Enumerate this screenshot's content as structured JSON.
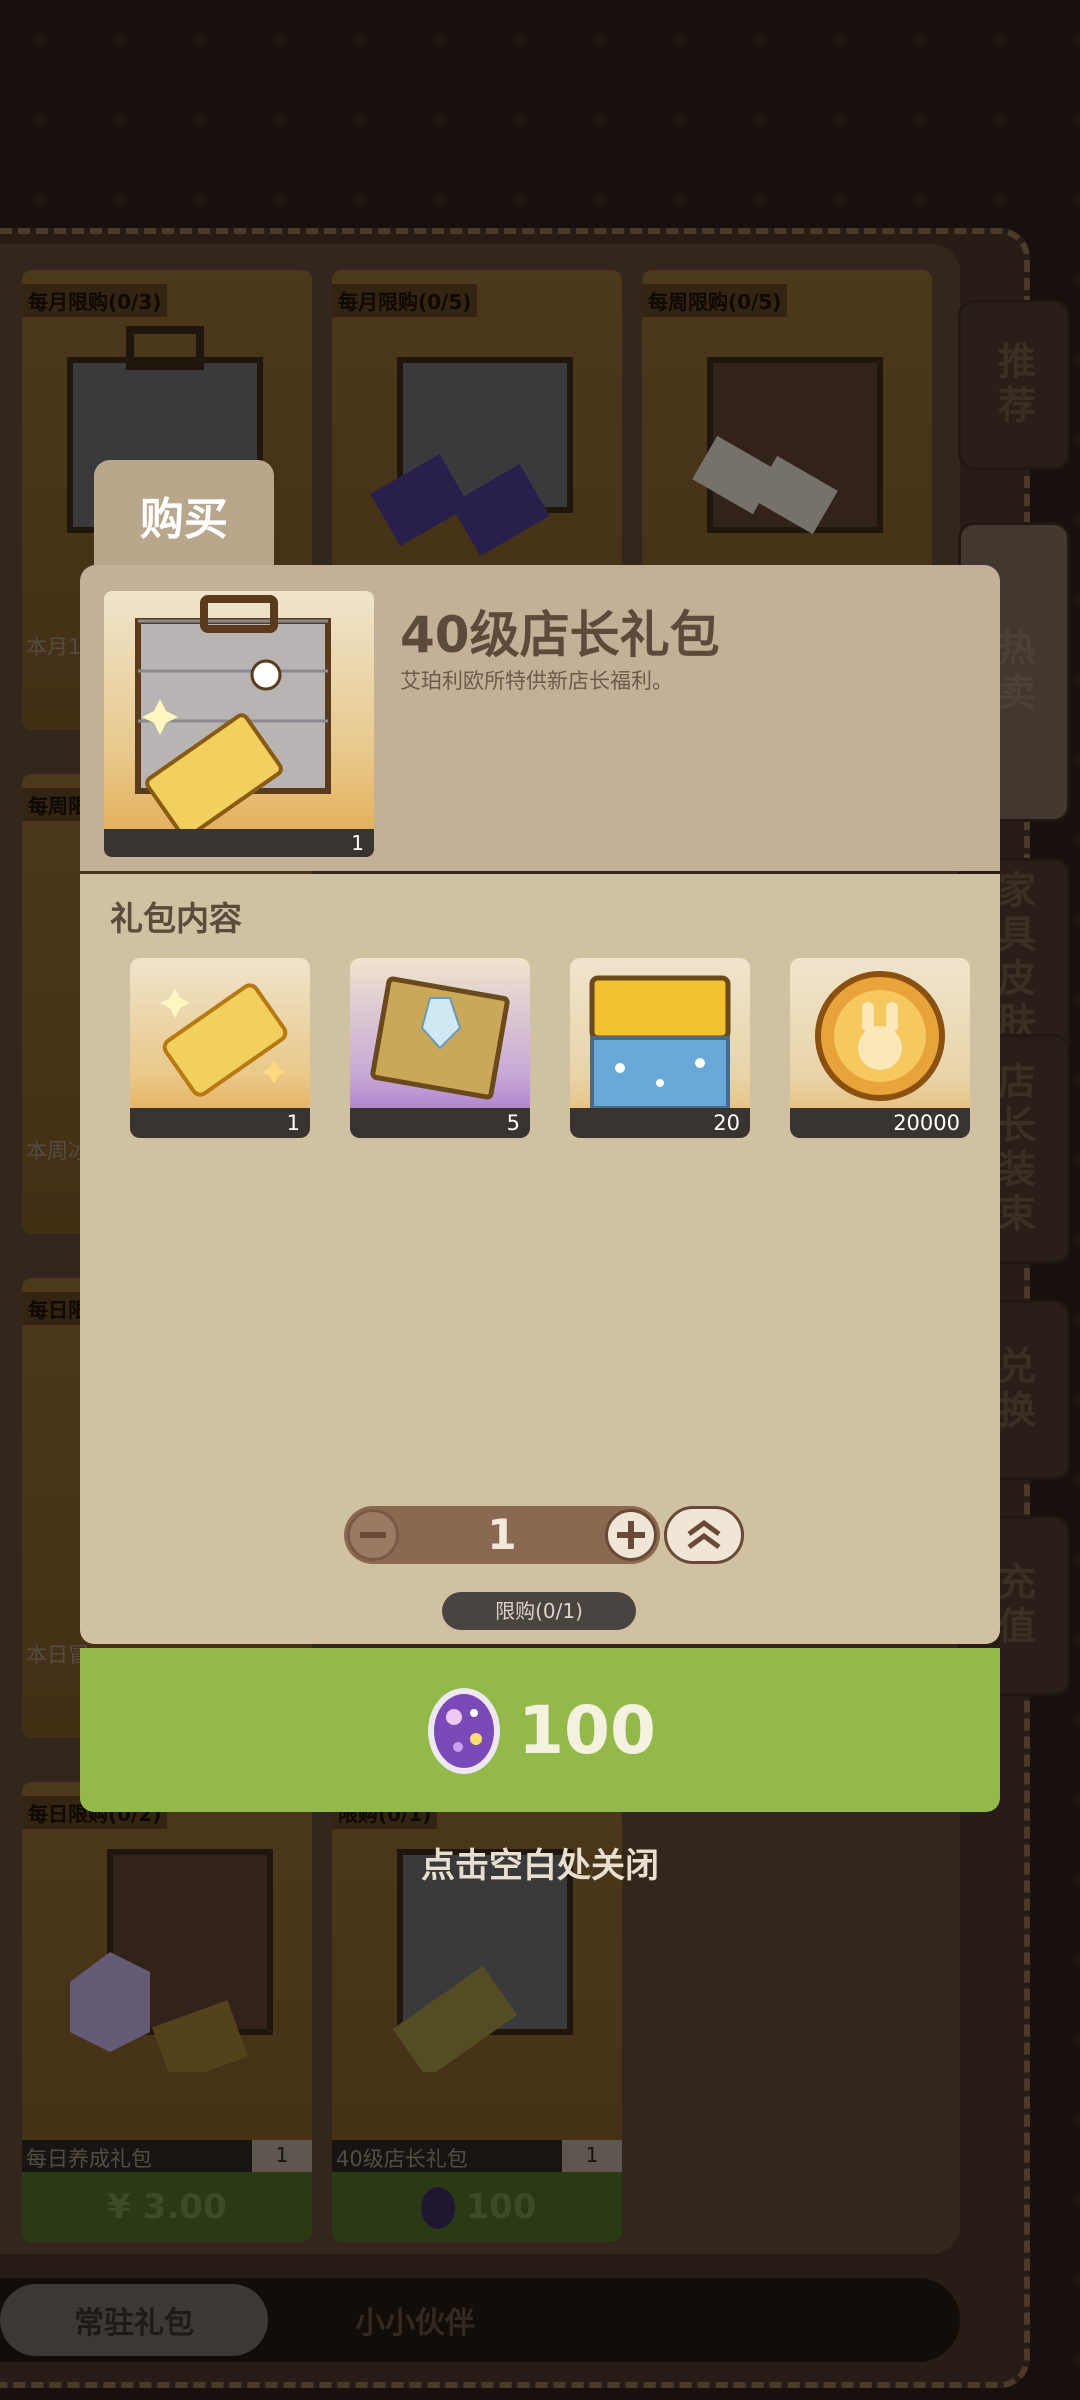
{
  "side_tabs": [
    "推荐",
    "热卖",
    "家具皮肤",
    "店长装束",
    "兑换",
    "充值"
  ],
  "cards": [
    {
      "limit": "每月限购(0/3)",
      "name": "本月1",
      "qty": "",
      "price": ""
    },
    {
      "limit": "每月限购(0/5)",
      "name": "",
      "qty": "",
      "price": ""
    },
    {
      "limit": "每周限购(0/5)",
      "name": "",
      "qty": "",
      "price": ""
    },
    {
      "limit": "每周限",
      "name": "本周冰",
      "qty": "",
      "price": ""
    },
    {
      "limit": "每日限",
      "name": "本日冒",
      "qty": "",
      "price": ""
    },
    {
      "limit": "每日限购(0/2)",
      "name": "每日养成礼包",
      "qty": "1",
      "price": "¥ 3.00"
    },
    {
      "limit": "限购(0/1)",
      "name": "40级店长礼包",
      "qty": "1",
      "price": "100"
    }
  ],
  "bottom_tabs": {
    "active": "常驻礼包",
    "other": "小小伙伴"
  },
  "modal": {
    "buy_tab": "购买",
    "title": "40级店长礼包",
    "description": "艾珀利欧所特供新店长福利。",
    "main_qty": "1",
    "section_label": "礼包内容",
    "items": [
      {
        "icon": "golden-ticket-icon",
        "qty": "1"
      },
      {
        "icon": "crystal-book-icon",
        "qty": "5"
      },
      {
        "icon": "blue-potion-jar-icon",
        "qty": "20"
      },
      {
        "icon": "bunny-coin-icon",
        "qty": "20000"
      }
    ],
    "quantity": "1",
    "purchase_limit": "限购(0/1)",
    "price": "100",
    "currency_icon": "purple-gem-egg-icon",
    "close_hint": "点击空白处关闭"
  },
  "colors": {
    "buy_button": "#93b94a",
    "header_panel": "#c2b197",
    "content_panel": "#cfc1a2"
  }
}
